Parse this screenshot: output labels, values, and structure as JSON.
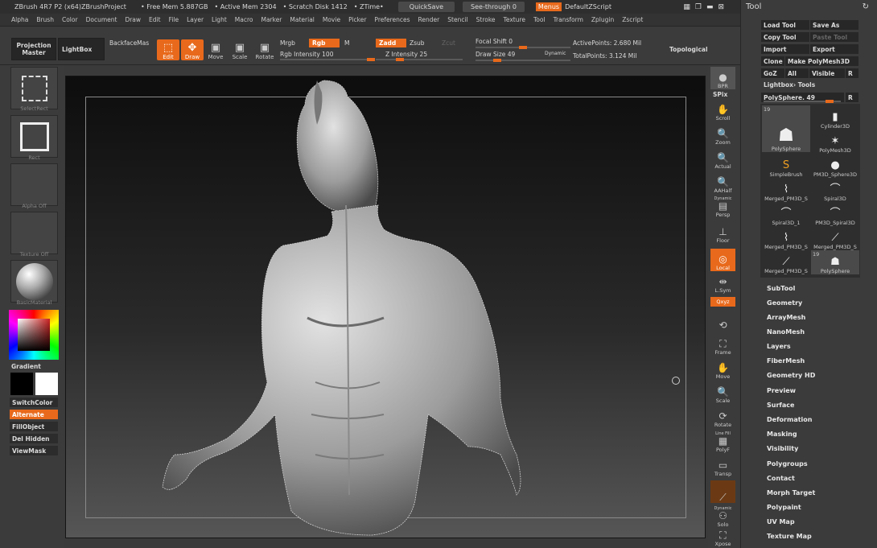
{
  "title": {
    "app": "ZBrush 4R7 P2 (x64)ZBrushProject",
    "free_mem": "• Free Mem 5.887GB",
    "active_mem": "• Active Mem 2304",
    "scratch": "• Scratch Disk 1412",
    "ztime": "• ZTime•",
    "quicksave": "QuickSave",
    "seethrough": "See-through  0",
    "menus": "Menus",
    "default_zscript": "DefaultZScript"
  },
  "menu": [
    "Alpha",
    "Brush",
    "Color",
    "Document",
    "Draw",
    "Edit",
    "File",
    "Layer",
    "Light",
    "Macro",
    "Marker",
    "Material",
    "Movie",
    "Picker",
    "Preferences",
    "Render",
    "Stencil",
    "Stroke",
    "Texture",
    "Tool",
    "Transform",
    "Zplugin",
    "Zscript"
  ],
  "shelf": {
    "projection_master": "Projection Master",
    "lightbox": "LightBox",
    "backface": "BackfaceMas",
    "edit": "Edit",
    "draw": "Draw",
    "move": "Move",
    "scale": "Scale",
    "rotate": "Rotate",
    "mrgb": "Mrgb",
    "rgb": "Rgb",
    "m": "M",
    "rgb_intensity": "Rgb Intensity 100",
    "zadd": "Zadd",
    "zsub": "Zsub",
    "zcut": "Zcut",
    "z_intensity": "Z Intensity 25",
    "focal_shift": "Focal Shift 0",
    "draw_size": "Draw Size 49",
    "dynamic": "Dynamic",
    "active_points": "ActivePoints: 2.680 Mil",
    "total_points": "TotalPoints: 3.124 Mil",
    "topological": "Topological",
    "rgb_intensity_level": 1.0,
    "z_intensity_level": 0.25,
    "focal_shift_level": 0.5,
    "draw_size_level": 0.2
  },
  "left": {
    "selectrect": "SelectRect",
    "rect": "Rect",
    "alpha": "Alpha  Off",
    "texture": "Texture  Off",
    "material": "BasicMaterial",
    "gradient": "Gradient",
    "switchcolor": "SwitchColor",
    "alternate": "Alternate",
    "fillobject": "FillObject",
    "delhidden": "Del Hidden",
    "viewmask": "ViewMask"
  },
  "right": {
    "bpr": "BPR",
    "spix": "SPix",
    "scroll": "Scroll",
    "zoom": "Zoom",
    "actual": "Actual",
    "aahalf": "AAHalf",
    "dynamic": "Dynamic",
    "persp": "Persp",
    "floor": "Floor",
    "local": "Local",
    "lsym": "L.Sym",
    "xyz": "Qxyz",
    "frame": "Frame",
    "move": "Move",
    "scale": "Scale",
    "rotate": "Rotate",
    "linefill": "Line Fill",
    "polyf": "PolyF",
    "transp": "Transp",
    "dynamic2": "Dynamic",
    "solo": "Solo",
    "xpose": "Xpose"
  },
  "tool": {
    "header": "Tool",
    "load": "Load Tool",
    "save": "Save As",
    "copy": "Copy Tool",
    "paste": "Paste Tool",
    "import": "Import",
    "export": "Export",
    "clone": "Clone",
    "make": "Make PolyMesh3D",
    "goz": "GoZ",
    "all": "All",
    "visible": "Visible",
    "r": "R",
    "lightbox_tools": "Lightbox› Tools",
    "current": "PolySphere. 49",
    "current_level": 0.9,
    "thumbs": [
      {
        "label": "PolySphere",
        "badge": "19",
        "icon": "☗"
      },
      {
        "label": "Cylinder3D",
        "icon": "▮"
      },
      {
        "label": "",
        "icon": ""
      },
      {
        "label": "PolyMesh3D",
        "icon": "✶"
      },
      {
        "label": "SimpleBrush",
        "icon": "S"
      },
      {
        "label": "PM3D_Sphere3D",
        "icon": "●"
      },
      {
        "label": "Merged_PM3D_S",
        "icon": "⌇"
      },
      {
        "label": "Spiral3D",
        "icon": "⌒"
      },
      {
        "label": "Spiral3D_1",
        "icon": "⌒"
      },
      {
        "label": "PM3D_Spiral3D",
        "icon": "⌒"
      },
      {
        "label": "Merged_PM3D_S",
        "icon": "⌇"
      },
      {
        "label": "Merged_PM3D_S",
        "icon": "⟋"
      },
      {
        "label": "Merged_PM3D_S",
        "icon": "⟋"
      },
      {
        "label": "PolySphere",
        "badge": "19",
        "icon": "☗"
      }
    ],
    "menus": [
      "SubTool",
      "Geometry",
      "ArrayMesh",
      "NanoMesh",
      "Layers",
      "FiberMesh",
      "Geometry HD",
      "Preview",
      "Surface",
      "Deformation",
      "Masking",
      "Visibility",
      "Polygroups",
      "Contact",
      "Morph Target",
      "Polypaint",
      "UV Map",
      "Texture Map"
    ]
  }
}
